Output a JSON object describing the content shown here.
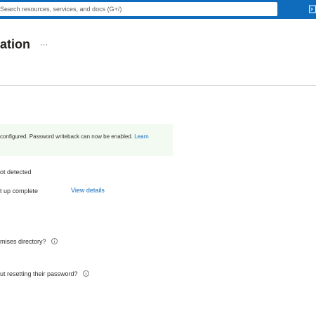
{
  "header": {
    "search_placeholder": "Search resources, services, and docs (G+/)"
  },
  "page": {
    "title": "ation",
    "more_label": "···"
  },
  "banner": {
    "text": "configured. Password writeback can now be enabled. ",
    "link_label": "Learn"
  },
  "status": {
    "line1": "ot detected",
    "line2": "t up complete",
    "view_details_label": "View details"
  },
  "questions": {
    "q1": "mises directory?",
    "q2": "ut resetting their password?"
  },
  "colors": {
    "accent": "#0f6cbd",
    "banner_bg": "#f3faf1"
  }
}
